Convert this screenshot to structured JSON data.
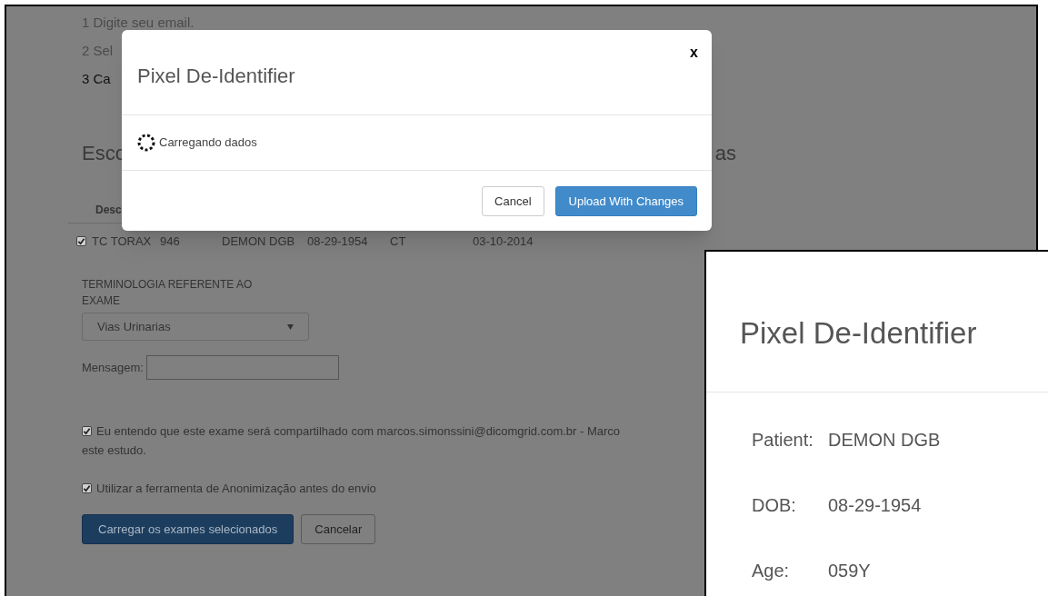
{
  "page": {
    "steps": [
      {
        "label": "1 Digite seu email.",
        "current": false
      },
      {
        "label": "2 Sel",
        "current": false
      },
      {
        "label": "3 Ca",
        "current": true
      }
    ],
    "heading_left": "Esco",
    "heading_right": "as",
    "table": {
      "columns": [
        "Desc"
      ],
      "rows": [
        {
          "selected": true,
          "cells": [
            "TC TORAX",
            "946",
            "DEMON DGB",
            "08-29-1954",
            "CT",
            "03-10-2014"
          ]
        }
      ]
    },
    "terminology": {
      "label": "TERMINOLOGIA REFERENTE AO EXAME",
      "value": "Vias Urinarias"
    },
    "message": {
      "label": "Mensagem:"
    },
    "agreements": [
      {
        "lines": [
          "Eu entendo que este exame será compartilhado com marcos.simonssini@dicomgrid.com.br - Marco",
          "este estudo."
        ],
        "checked": true
      },
      {
        "lines": [
          "Utilizar a ferramenta de Anonimização antes do envio"
        ],
        "checked": true
      }
    ],
    "buttons": [
      {
        "label": "Carregar os exames selecionados",
        "kind": "primary"
      },
      {
        "label": "Cancelar",
        "kind": "default"
      }
    ]
  },
  "modal": {
    "title": "Pixel De-Identifier",
    "close": "x",
    "status": "Carregando dados",
    "buttons": [
      {
        "label": "Cancel",
        "kind": "default"
      },
      {
        "label": "Upload With Changes",
        "kind": "primary"
      }
    ]
  },
  "zoom_inset": {
    "title": "Pixel De-Identifier",
    "fields": [
      {
        "label": "Patient:",
        "value": "DEMON DGB"
      },
      {
        "label": "DOB:",
        "value": "08-29-1954"
      },
      {
        "label": "Age:",
        "value": "059Y"
      }
    ]
  }
}
